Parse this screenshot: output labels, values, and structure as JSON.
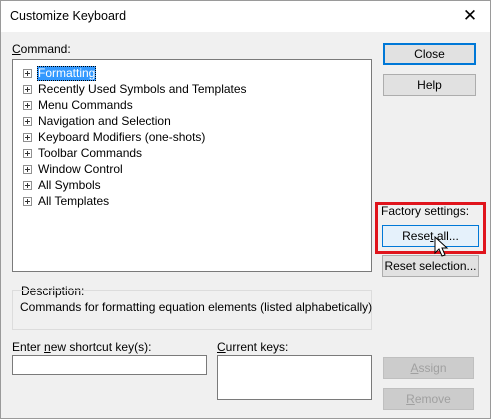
{
  "window": {
    "title": "Customize Keyboard",
    "close_glyph": "✕"
  },
  "command": {
    "label": "Command:",
    "items": [
      {
        "label": "Formatting",
        "selected": true
      },
      {
        "label": "Recently Used Symbols and Templates"
      },
      {
        "label": "Menu Commands"
      },
      {
        "label": "Navigation and Selection"
      },
      {
        "label": "Keyboard Modifiers (one-shots)"
      },
      {
        "label": "Toolbar Commands"
      },
      {
        "label": "Window Control"
      },
      {
        "label": "All Symbols"
      },
      {
        "label": "All Templates"
      }
    ]
  },
  "buttons": {
    "close": "Close",
    "help": "Help",
    "reset_all": "Reset all...",
    "reset_selection": "Reset selection...",
    "assign": "Assign",
    "remove": "Remove"
  },
  "factory": {
    "label": "Factory settings:"
  },
  "description": {
    "label": "Description:",
    "text": "Commands for formatting equation elements  (listed alphabetically)"
  },
  "shortcut": {
    "label": "Enter new shortcut key(s):",
    "value": ""
  },
  "current_keys": {
    "label": "Current keys:"
  },
  "colors": {
    "selection": "#3399ff",
    "highlight_box": "#e0141c",
    "default_button_border": "#0078d7"
  },
  "icons": {
    "expand": "plus-box-icon",
    "cursor": "mouse-pointer-icon",
    "close": "close-icon"
  }
}
